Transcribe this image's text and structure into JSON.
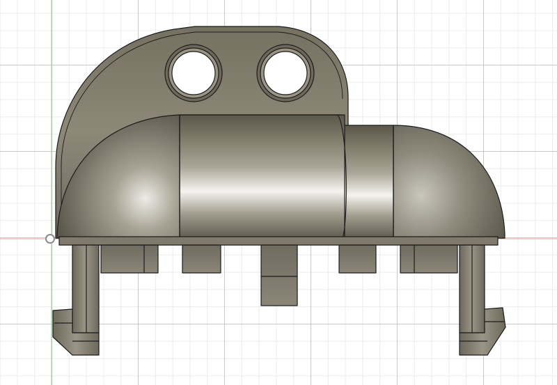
{
  "viewport": {
    "background_color": "#ffffff",
    "grid_major_color": "#c9c9c9",
    "grid_minor_color": "#ececec",
    "x_axis_color": "#f09a9a",
    "y_axis_color": "#8fd48f"
  },
  "model": {
    "body_color": "#8a8478",
    "edge_color": "#1c1c1c",
    "highlight_color": "#f4f3ef"
  },
  "icons": {
    "origin_marker": "origin-point-icon"
  }
}
